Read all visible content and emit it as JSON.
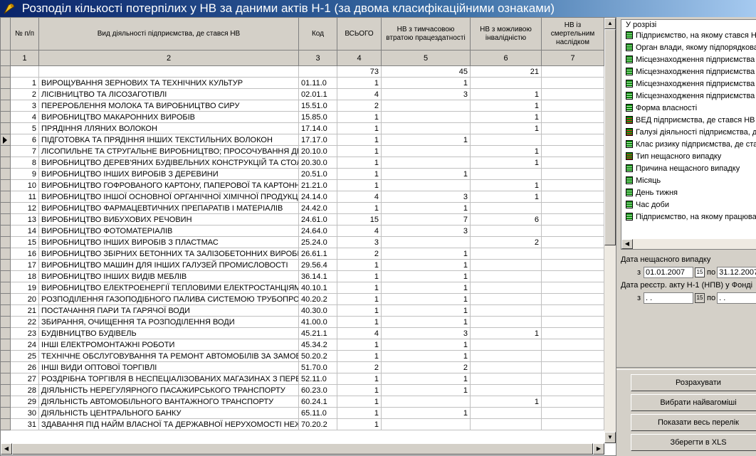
{
  "window": {
    "title": "Розподіл кількості потерпілих у НВ за даними актів Н-1 (за двома класифікаційними ознаками)"
  },
  "table": {
    "headers": {
      "num": "№ п/п",
      "name": "Вид діяльності підприємства, де стався НВ",
      "code": "Код",
      "total": "ВСЬОГО",
      "temp": "НВ з тимчасовою втратою працездатності",
      "dis": "НВ з можливою інвалідністю",
      "death": "НВ із смертельним наслідком"
    },
    "col_numbers": [
      "1",
      "2",
      "3",
      "4",
      "5",
      "6",
      "7"
    ],
    "rows": [
      {
        "num": "",
        "name": "",
        "code": "",
        "total": "73",
        "temp": "45",
        "dis": "21",
        "death": ""
      },
      {
        "num": "1",
        "name": "ВИРОЩУВАННЯ ЗЕРНОВИХ ТА ТЕХНІЧНИХ КУЛЬТУР",
        "code": "01.11.0",
        "total": "1",
        "temp": "1",
        "dis": "",
        "death": ""
      },
      {
        "num": "2",
        "name": "ЛІСІВНИЦТВО ТА ЛІСОЗАГОТІВЛІ",
        "code": "02.01.1",
        "total": "4",
        "temp": "3",
        "dis": "1",
        "death": ""
      },
      {
        "num": "3",
        "name": "ПЕРЕРОБЛЕННЯ МОЛОКА ТА ВИРОБНИЦТВО СИРУ",
        "code": "15.51.0",
        "total": "2",
        "temp": "",
        "dis": "1",
        "death": ""
      },
      {
        "num": "4",
        "name": "ВИРОБНИЦТВО МАКАРОННИХ ВИРОБІВ",
        "code": "15.85.0",
        "total": "1",
        "temp": "",
        "dis": "1",
        "death": ""
      },
      {
        "num": "5",
        "name": "ПРЯДІННЯ ЛЛЯНИХ ВОЛОКОН",
        "code": "17.14.0",
        "total": "1",
        "temp": "",
        "dis": "1",
        "death": ""
      },
      {
        "num": "6",
        "name": "ПІДГОТОВКА ТА ПРЯДІННЯ ІНШИХ ТЕКСТИЛЬНИХ ВОЛОКОН",
        "code": "17.17.0",
        "total": "1",
        "temp": "1",
        "dis": "",
        "death": ""
      },
      {
        "num": "7",
        "name": "ЛІСОПИЛЬНЕ ТА СТРУГАЛЬНЕ ВИРОБНИЦТВО; ПРОСОЧУВАННЯ ДЕРЕВИНИ",
        "code": "20.10.0",
        "total": "1",
        "temp": "",
        "dis": "1",
        "death": ""
      },
      {
        "num": "8",
        "name": "ВИРОБНИЦТВО ДЕРЕВ'ЯНИХ БУДІВЕЛЬНИХ КОНСТРУКЦІЙ ТА СТОЛЯРНИХ ВИРОБІВ",
        "code": "20.30.0",
        "total": "1",
        "temp": "",
        "dis": "1",
        "death": ""
      },
      {
        "num": "9",
        "name": "ВИРОБНИЦТВО ІНШИХ ВИРОБІВ З ДЕРЕВИНИ",
        "code": "20.51.0",
        "total": "1",
        "temp": "1",
        "dis": "",
        "death": ""
      },
      {
        "num": "10",
        "name": "ВИРОБНИЦТВО ГОФРОВАНОГО КАРТОНУ, ПАПЕРОВОЇ ТА КАРТОННОЇ ТАРИ",
        "code": "21.21.0",
        "total": "1",
        "temp": "",
        "dis": "1",
        "death": ""
      },
      {
        "num": "11",
        "name": "ВИРОБНИЦТВО ІНШОЇ ОСНОВНОЇ ОРГАНІЧНОЇ ХІМІЧНОЇ ПРОДУКЦІЇ",
        "code": "24.14.0",
        "total": "4",
        "temp": "3",
        "dis": "1",
        "death": ""
      },
      {
        "num": "12",
        "name": "ВИРОБНИЦТВО ФАРМАЦЕВТИЧНИХ ПРЕПАРАТІВ І МАТЕРІАЛІВ",
        "code": "24.42.0",
        "total": "1",
        "temp": "1",
        "dis": "",
        "death": ""
      },
      {
        "num": "13",
        "name": "ВИРОБНИЦТВО ВИБУХОВИХ РЕЧОВИН",
        "code": "24.61.0",
        "total": "15",
        "temp": "7",
        "dis": "6",
        "death": ""
      },
      {
        "num": "14",
        "name": "ВИРОБНИЦТВО ФОТОМАТЕРІАЛІВ",
        "code": "24.64.0",
        "total": "4",
        "temp": "3",
        "dis": "",
        "death": ""
      },
      {
        "num": "15",
        "name": "ВИРОБНИЦТВО ІНШИХ ВИРОБІВ З ПЛАСТМАС",
        "code": "25.24.0",
        "total": "3",
        "temp": "",
        "dis": "2",
        "death": ""
      },
      {
        "num": "16",
        "name": "ВИРОБНИЦТВО ЗБІРНИХ БЕТОННИХ ТА ЗАЛІЗОБЕТОННИХ ВИРОБІВ",
        "code": "26.61.1",
        "total": "2",
        "temp": "1",
        "dis": "",
        "death": ""
      },
      {
        "num": "17",
        "name": "ВИРОБНИЦТВО МАШИН ДЛЯ ІНШИХ ГАЛУЗЕЙ ПРОМИСЛОВОСТІ",
        "code": "29.56.4",
        "total": "1",
        "temp": "1",
        "dis": "",
        "death": ""
      },
      {
        "num": "18",
        "name": "ВИРОБНИЦТВО ІНШИХ ВИДІВ МЕБЛІВ",
        "code": "36.14.1",
        "total": "1",
        "temp": "1",
        "dis": "",
        "death": ""
      },
      {
        "num": "19",
        "name": "ВИРОБНИЦТВО ЕЛЕКТРОЕНЕРГІЇ ТЕПЛОВИМИ ЕЛЕКТРОСТАНЦІЯМИ",
        "code": "40.10.1",
        "total": "1",
        "temp": "1",
        "dis": "",
        "death": ""
      },
      {
        "num": "20",
        "name": "РОЗПОДІЛЕННЯ ГАЗОПОДІБНОГО ПАЛИВА СИСТЕМОЮ ТРУБОПРОВОДІВ",
        "code": "40.20.2",
        "total": "1",
        "temp": "1",
        "dis": "",
        "death": ""
      },
      {
        "num": "21",
        "name": "ПОСТАЧАННЯ ПАРИ ТА ГАРЯЧОЇ ВОДИ",
        "code": "40.30.0",
        "total": "1",
        "temp": "1",
        "dis": "",
        "death": ""
      },
      {
        "num": "22",
        "name": "ЗБИРАННЯ, ОЧИЩЕННЯ ТА РОЗПОДІЛЕННЯ ВОДИ",
        "code": "41.00.0",
        "total": "1",
        "temp": "1",
        "dis": "",
        "death": ""
      },
      {
        "num": "23",
        "name": "БУДІВНИЦТВО БУДІВЕЛЬ",
        "code": "45.21.1",
        "total": "4",
        "temp": "3",
        "dis": "1",
        "death": ""
      },
      {
        "num": "24",
        "name": "ІНШІ ЕЛЕКТРОМОНТАЖНІ РОБОТИ",
        "code": "45.34.2",
        "total": "1",
        "temp": "1",
        "dis": "",
        "death": ""
      },
      {
        "num": "25",
        "name": "ТЕХНІЧНЕ ОБСЛУГОВУВАННЯ ТА РЕМОНТ АВТОМОБІЛІВ ЗА ЗАМОВЛЕННЯМ",
        "code": "50.20.2",
        "total": "1",
        "temp": "1",
        "dis": "",
        "death": ""
      },
      {
        "num": "26",
        "name": "ІНШІ ВИДИ ОПТОВОЇ ТОРГІВЛІ",
        "code": "51.70.0",
        "total": "2",
        "temp": "2",
        "dis": "",
        "death": ""
      },
      {
        "num": "27",
        "name": "РОЗДРІБНА ТОРГІВЛЯ В НЕСПЕЦІАЛІЗОВАНИХ МАГАЗИНАХ З ПЕРЕВАГОЮ",
        "code": "52.11.0",
        "total": "1",
        "temp": "1",
        "dis": "",
        "death": ""
      },
      {
        "num": "28",
        "name": "ДІЯЛЬНІСТЬ НЕРЕГУЛЯРНОГО ПАСАЖИРСЬКОГО ТРАНСПОРТУ",
        "code": "60.23.0",
        "total": "1",
        "temp": "1",
        "dis": "",
        "death": ""
      },
      {
        "num": "29",
        "name": "ДІЯЛЬНІСТЬ АВТОМОБІЛЬНОГО ВАНТАЖНОГО ТРАНСПОРТУ",
        "code": "60.24.1",
        "total": "1",
        "temp": "",
        "dis": "1",
        "death": ""
      },
      {
        "num": "30",
        "name": "ДІЯЛЬНІСТЬ ЦЕНТРАЛЬНОГО БАНКУ",
        "code": "65.11.0",
        "total": "1",
        "temp": "1",
        "dis": "",
        "death": ""
      },
      {
        "num": "31",
        "name": "ЗДАВАННЯ ПІД НАЙМ ВЛАСНОЇ ТА ДЕРЖАВНОЇ НЕРУХОМОСТІ НЕЖИТЛОВОГО",
        "code": "70.20.2",
        "total": "1",
        "temp": "",
        "dis": "",
        "death": ""
      }
    ],
    "current_row_index": 6
  },
  "panel": {
    "title": "У розрізі",
    "items": [
      {
        "label": "Підприємство, на якому стався НВ",
        "icon": "list-green"
      },
      {
        "label": "Орган влади, якому підпорядковане",
        "icon": "list-green"
      },
      {
        "label": "Місцезнаходження підприємства",
        "icon": "list-green"
      },
      {
        "label": "Місцезнаходження підприємства",
        "icon": "list-green"
      },
      {
        "label": "Місцезнаходження підприємства",
        "icon": "list-green"
      },
      {
        "label": "Місцезнаходження підприємства",
        "icon": "list-green"
      },
      {
        "label": "Форма власності",
        "icon": "list-green"
      },
      {
        "label": "ВЕД підприємства, де стався НВ",
        "icon": "list-red"
      },
      {
        "label": "Галузі діяльності підприємства, де",
        "icon": "list-red"
      },
      {
        "label": "Клас ризику підприємства, де стався",
        "icon": "list-green"
      },
      {
        "label": "Тип нещасного випадку",
        "icon": "list-red"
      },
      {
        "label": "Причина нещасного випадку",
        "icon": "list-green"
      },
      {
        "label": "Місяць",
        "icon": "list-green"
      },
      {
        "label": "День тижня",
        "icon": "list-green"
      },
      {
        "label": "Час доби",
        "icon": "list-green"
      },
      {
        "label": "Підприємство, на якому працював",
        "icon": "list-green"
      }
    ]
  },
  "filters": {
    "accident_date_label": "Дата нещасного випадку",
    "from_label": "з",
    "to_label": "по",
    "accident_from": "01.01.2007",
    "accident_to": "31.12.2007",
    "reg_date_label": "Дата реєстр. акту Н-1 (НПВ) у Фонді",
    "reg_from": " . .",
    "reg_to": " . .",
    "calendar_glyph": "15"
  },
  "buttons": {
    "calculate": "Розрахувати",
    "top": "Вибрати найвагоміші",
    "show_all": "Показати весь перелік",
    "save_xls": "Зберегти в XLS"
  },
  "colors": {
    "title_start": "#0a246a",
    "title_end": "#a6caf0",
    "face": "#d4d0c8"
  }
}
